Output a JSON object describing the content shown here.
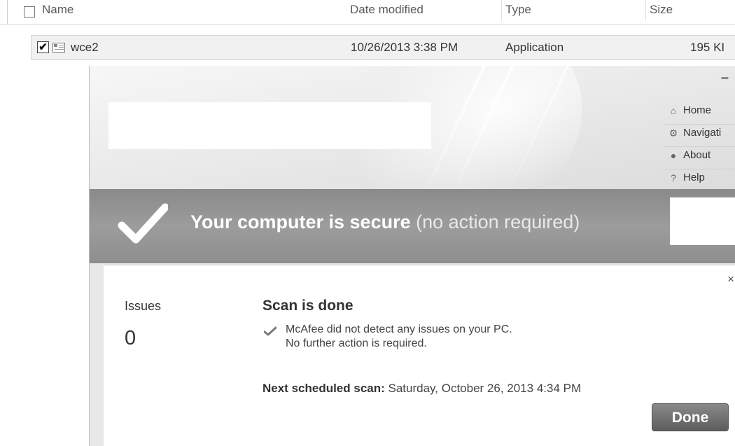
{
  "explorer": {
    "columns": {
      "name": "Name",
      "date_modified": "Date modified",
      "type": "Type",
      "size": "Size"
    },
    "files": [
      {
        "checked": true,
        "icon": "application-icon",
        "name": "wce2",
        "date_modified": "10/26/2013 3:38 PM",
        "type": "Application",
        "size": "195 KI"
      }
    ]
  },
  "mcafee": {
    "minimize_glyph": "–",
    "nav": [
      {
        "icon": "home-icon",
        "label": "Home"
      },
      {
        "icon": "gear-icon",
        "label": "Navigati"
      },
      {
        "icon": "shield-icon",
        "label": "About"
      },
      {
        "icon": "question-icon",
        "label": "Help"
      }
    ],
    "status": {
      "headline": "Your computer is secure",
      "detail": " (no action required)"
    },
    "panel": {
      "close_glyph": "×",
      "issues_label": "Issues",
      "issues_count": "0",
      "scan_title": "Scan is done",
      "scan_message_line1": "McAfee did not detect any issues on your PC.",
      "scan_message_line2": "No further action is required.",
      "next_scan_label": "Next scheduled scan:",
      "next_scan_value": " Saturday, October 26, 2013 4:34 PM",
      "done_button": "Done"
    }
  },
  "colors": {
    "status_bar": "#919191",
    "done_button": "#6e6e6e",
    "panel_bg": "#ffffff"
  }
}
